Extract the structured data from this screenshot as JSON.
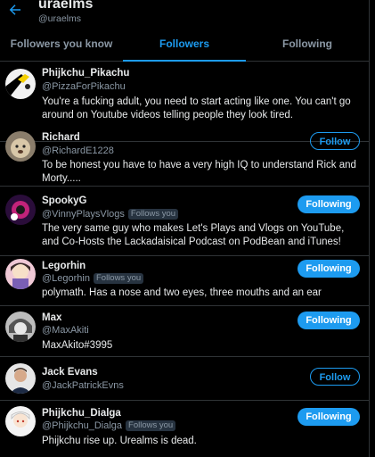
{
  "header": {
    "name": "uraelms",
    "handle": "@uraelms",
    "back_icon": "arrow-left-icon"
  },
  "tabs": [
    {
      "label": "Followers you know",
      "active": false
    },
    {
      "label": "Followers",
      "active": true
    },
    {
      "label": "Following",
      "active": false
    }
  ],
  "users": [
    {
      "name": "Phijkchu_Pikachu",
      "handle": "@PizzaForPikachu",
      "follows_you": false,
      "button": "",
      "bio": "You're a fucking adult, you need to start acting like one. You can't go around on Youtube videos telling people they look tired."
    },
    {
      "name": "Richard",
      "handle": "@RichardE1228",
      "follows_you": false,
      "button": "Follow",
      "bio": "To be honest you have to have a very high IQ to understand Rick and Morty....."
    },
    {
      "name": "SpookyG",
      "handle": "@VinnyPlaysVlogs",
      "follows_you": true,
      "follows_you_label": "Follows you",
      "button": "Following",
      "bio": "The very same guy who makes Let's Plays and Vlogs on YouTube, and Co-Hosts the Lackadaisical Podcast on PodBean and iTunes!"
    },
    {
      "name": "Legorhin",
      "handle": "@Legorhin",
      "follows_you": true,
      "follows_you_label": "Follows you",
      "button": "Following",
      "bio": "polymath. Has a nose and two eyes, three mouths and an ear"
    },
    {
      "name": "Max",
      "handle": "@MaxAkiti",
      "follows_you": false,
      "button": "Following",
      "bio": "MaxAkito#3995"
    },
    {
      "name": "Jack Evans",
      "handle": "@JackPatrickEvns",
      "follows_you": false,
      "button": "Follow",
      "bio": ""
    },
    {
      "name": "Phijkchu_Dialga",
      "handle": "@Phijkchu_Dialga",
      "follows_you": true,
      "follows_you_label": "Follows you",
      "button": "Following",
      "bio": "Phijkchu rise up. Urealms is dead."
    }
  ],
  "colors": {
    "accent": "#1d9bf0",
    "background": "#000000",
    "divider": "#2f3336",
    "secondary_text": "#8b98a5"
  }
}
